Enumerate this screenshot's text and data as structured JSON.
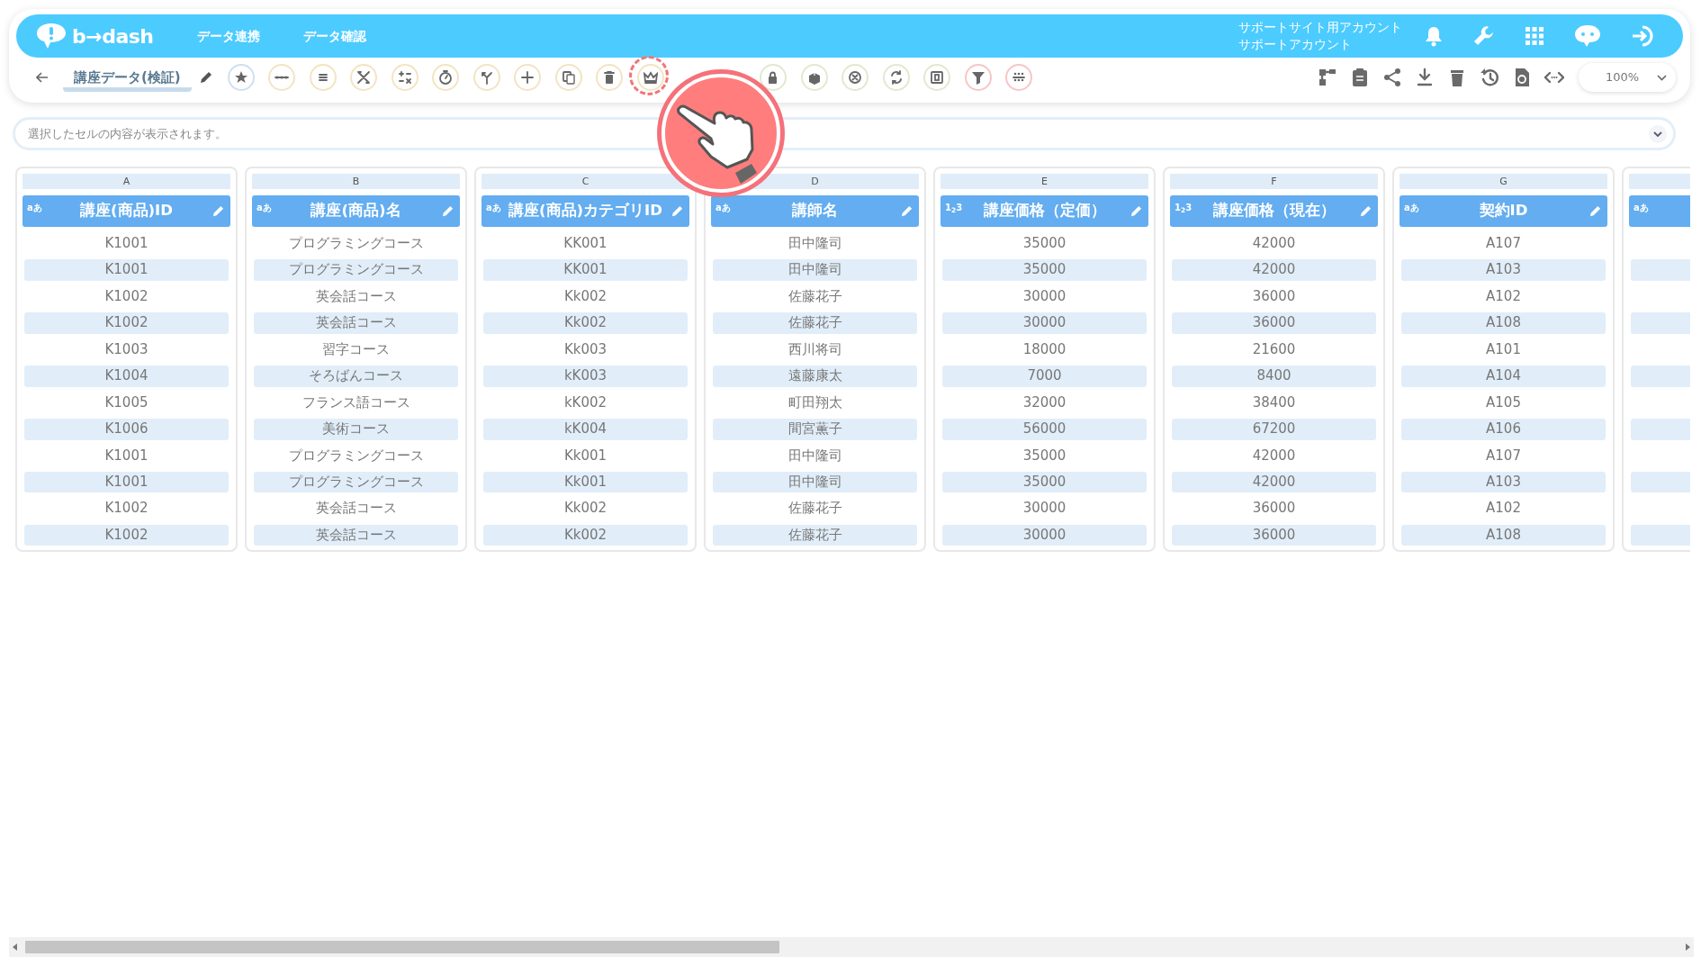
{
  "header": {
    "logo": "b→dash",
    "nav": [
      "データ連携",
      "データ確認"
    ],
    "account": [
      "サポートサイト用アカウント",
      "サポートアカウント"
    ]
  },
  "toolbar": {
    "title": "講座データ(検証)",
    "zoom": "100%"
  },
  "cell_display": {
    "placeholder": "選択したセルの内容が表示されます。"
  },
  "columns": [
    {
      "letter": "A",
      "type_label": "aあ",
      "name": "講座(商品)ID",
      "cells": [
        "K1001",
        "K1001",
        "K1002",
        "K1002",
        "K1003",
        "K1004",
        "K1005",
        "K1006",
        "K1001",
        "K1001",
        "K1002",
        "K1002"
      ]
    },
    {
      "letter": "B",
      "type_label": "aあ",
      "name": "講座(商品)名",
      "cells": [
        "プログラミングコース",
        "プログラミングコース",
        "英会話コース",
        "英会話コース",
        "習字コース",
        "そろばんコース",
        "フランス語コース",
        "美術コース",
        "プログラミングコース",
        "プログラミングコース",
        "英会話コース",
        "英会話コース"
      ]
    },
    {
      "letter": "C",
      "type_label": "aあ",
      "name": "講座(商品)カテゴリID",
      "cells": [
        "KK001",
        "KK001",
        "Kk002",
        "Kk002",
        "Kk003",
        "kK003",
        "kK002",
        "kK004",
        "Kk001",
        "Kk001",
        "Kk002",
        "Kk002"
      ]
    },
    {
      "letter": "D",
      "type_label": "aあ",
      "name": "講師名",
      "cells": [
        "田中隆司",
        "田中隆司",
        "佐藤花子",
        "佐藤花子",
        "西川将司",
        "遠藤康太",
        "町田翔太",
        "間宮薫子",
        "田中隆司",
        "田中隆司",
        "佐藤花子",
        "佐藤花子"
      ]
    },
    {
      "letter": "E",
      "type_label": "1$_{2}$3",
      "name": "講座価格（定価）",
      "cells": [
        "35000",
        "35000",
        "30000",
        "30000",
        "18000",
        "7000",
        "32000",
        "56000",
        "35000",
        "35000",
        "30000",
        "30000"
      ]
    },
    {
      "letter": "F",
      "type_label": "1$_{2}$3",
      "name": "講座価格（現在）",
      "cells": [
        "42000",
        "42000",
        "36000",
        "36000",
        "21600",
        "8400",
        "38400",
        "67200",
        "42000",
        "42000",
        "36000",
        "36000"
      ]
    },
    {
      "letter": "G",
      "type_label": "aあ",
      "name": "契約ID",
      "cells": [
        "A107",
        "A103",
        "A102",
        "A108",
        "A101",
        "A104",
        "A105",
        "A106",
        "A107",
        "A103",
        "A102",
        "A108"
      ]
    },
    {
      "type_label": "aあ"
    }
  ]
}
